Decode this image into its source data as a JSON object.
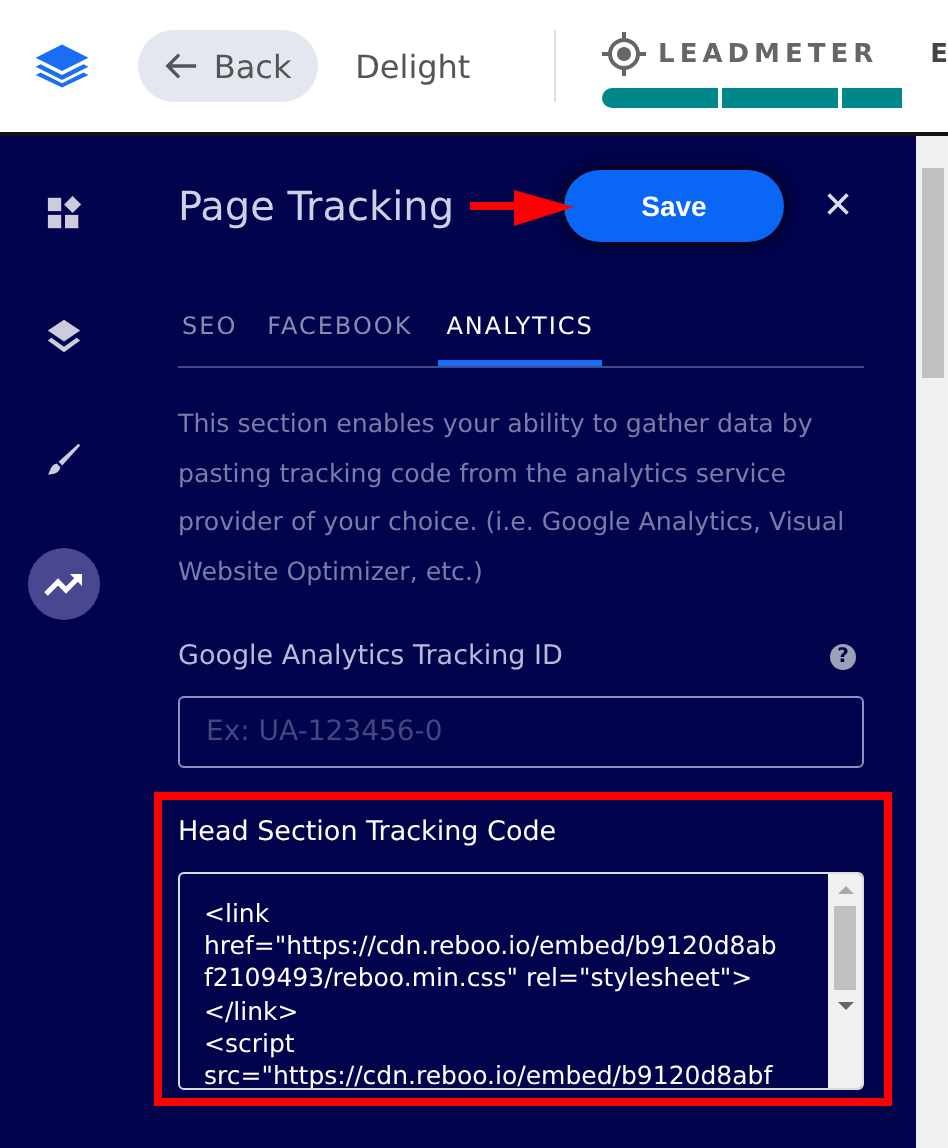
{
  "topbar": {
    "back_label": "Back",
    "page_name": "Delight",
    "leadmeter_label": "LEADMETER",
    "cut_label": "E"
  },
  "sidebar": {
    "items": [
      {
        "selected": false
      },
      {
        "selected": false
      },
      {
        "selected": false
      },
      {
        "selected": true
      }
    ]
  },
  "panel": {
    "title": "Page Tracking",
    "save_label": "Save",
    "close_label": "×",
    "tabs": [
      {
        "label": "SEO",
        "selected": false
      },
      {
        "label": "FACEBOOK",
        "selected": false
      },
      {
        "label": "ANALYTICS",
        "selected": true
      }
    ],
    "description": "This section enables your ability to gather data by pasting tracking code from the analytics service provider of your choice. (i.e. Google Analytics, Visual Website Optimizer, etc.)",
    "ga_label": "Google Analytics Tracking ID",
    "ga_help": "?",
    "ga_field": {
      "placeholder": "Ex: UA-123456-0"
    },
    "head_label": "Head Section Tracking Code",
    "head_code": [
      "<link",
      "href=\"https://cdn.reboo.io/embed/b9120d8ab",
      "f2109493/reboo.min.css\" rel=\"stylesheet\">",
      "</link>",
      "<script",
      "src=\"https://cdn.reboo.io/embed/b9120d8abf"
    ]
  }
}
